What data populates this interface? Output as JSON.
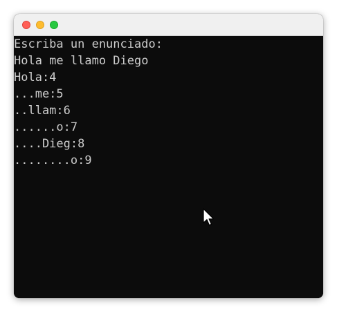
{
  "window": {
    "buttons": {
      "close": {
        "color": "#ff5f57"
      },
      "minimize": {
        "color": "#febc2e"
      },
      "maximize": {
        "color": "#28c840"
      }
    }
  },
  "terminal": {
    "background": "#0c0c0c",
    "text_color": "#cccccc",
    "lines": [
      "Escriba un enunciado:",
      "Hola me llamo Diego",
      "Hola:4",
      "...me:5",
      "..llam:6",
      "......o:7",
      "....Dieg:8",
      "........o:9"
    ]
  },
  "pointer": {
    "icon": "mouse-pointer-icon"
  }
}
